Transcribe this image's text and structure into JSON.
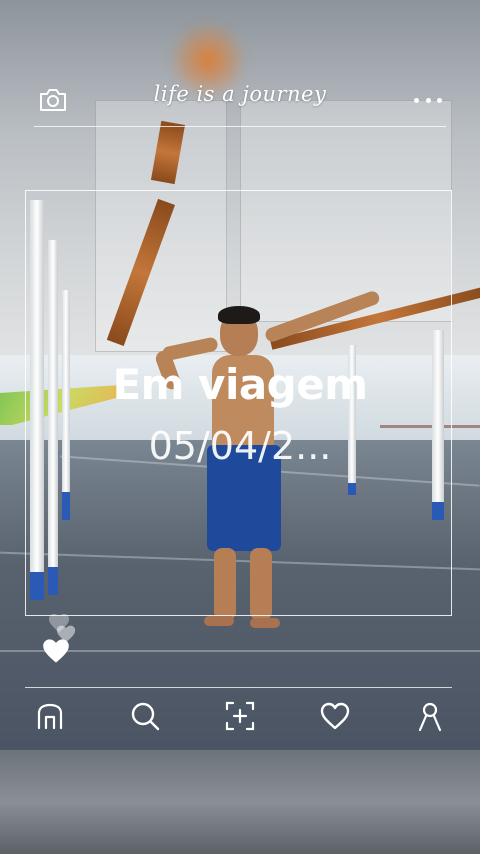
{
  "header": {
    "brand": "life is a journey",
    "camera_icon": "camera-icon",
    "more_icon": "more-dots-icon"
  },
  "post": {
    "title": "Em viagem",
    "date": "05/04/2..."
  },
  "likes": {
    "icon": "heart-icon"
  },
  "nav": {
    "items": [
      {
        "icon": "home-icon"
      },
      {
        "icon": "search-icon"
      },
      {
        "icon": "add-post-icon"
      },
      {
        "icon": "heart-icon"
      },
      {
        "icon": "profile-icon"
      }
    ]
  },
  "colors": {
    "overlay_text": "#ffffff",
    "shorts_blue": "#1f4a9c",
    "pillar_base": "#2a5ab5"
  }
}
